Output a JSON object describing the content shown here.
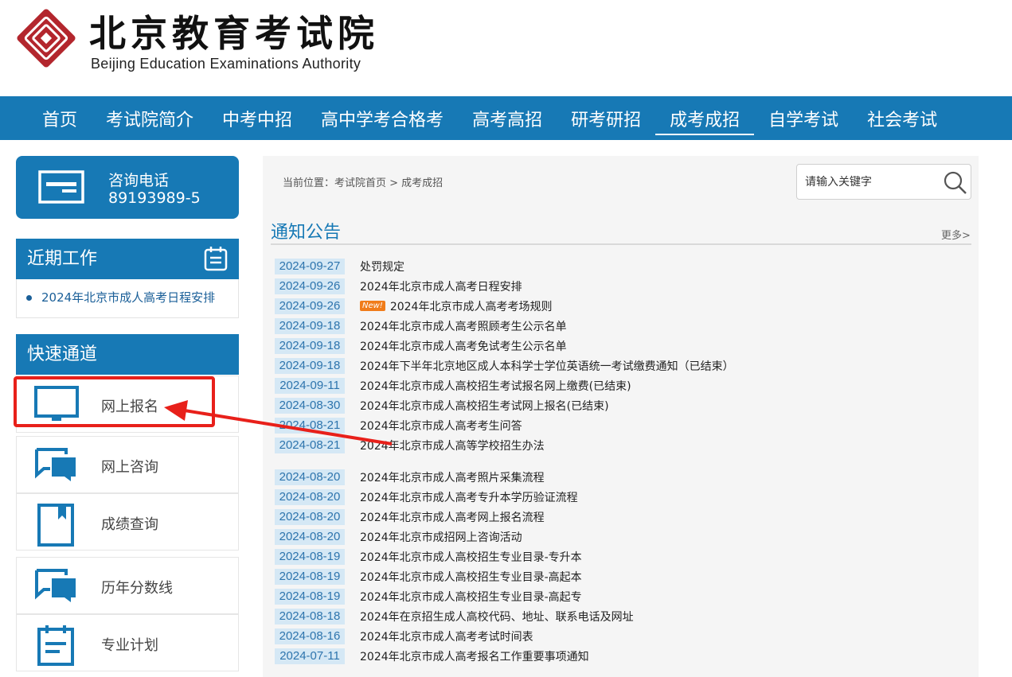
{
  "header": {
    "logo_cn": "北京教育考试院",
    "logo_en": "Beijing Education Examinations Authority"
  },
  "nav": {
    "items": [
      "首页",
      "考试院简介",
      "中考中招",
      "高中学考合格考",
      "高考高招",
      "研考研招",
      "成考成招",
      "自学考试",
      "社会考试"
    ],
    "active": "成考成招"
  },
  "hotline": {
    "label": "咨询电话",
    "number": "89193989-5"
  },
  "recent": {
    "title": "近期工作",
    "item": "2024年北京市成人高考日程安排"
  },
  "quick": {
    "title": "快速通道",
    "items": [
      "网上报名",
      "网上咨询",
      "成绩查询",
      "历年分数线",
      "专业计划"
    ]
  },
  "breadcrumb": "当前位置：考试院首页 > 成考成招",
  "search": {
    "placeholder": "请输入关键字"
  },
  "notice": {
    "title": "通知公告",
    "more": "更多>"
  },
  "news": [
    {
      "date": "2024-09-27",
      "title": "处罚规定"
    },
    {
      "date": "2024-09-26",
      "title": "2024年北京市成人高考日程安排"
    },
    {
      "date": "2024-09-26",
      "title": "2024年北京市成人高考考场规则",
      "badge": "New!"
    },
    {
      "date": "2024-09-18",
      "title": "2024年北京市成人高考照顾考生公示名单"
    },
    {
      "date": "2024-09-18",
      "title": "2024年北京市成人高考免试考生公示名单"
    },
    {
      "date": "2024-09-18",
      "title": "2024年下半年北京地区成人本科学士学位英语统一考试缴费通知（已结束）"
    },
    {
      "date": "2024-09-11",
      "title": "2024年北京市成人高校招生考试报名网上缴费(已结束)"
    },
    {
      "date": "2024-08-30",
      "title": "2024年北京市成人高校招生考试网上报名(已结束)"
    },
    {
      "date": "2024-08-21",
      "title": "2024年北京市成人高考考生问答"
    },
    {
      "date": "2024-08-21",
      "title": "2024年北京市成人高等学校招生办法"
    },
    {
      "date": "2024-08-20",
      "title": "2024年北京市成人高考照片采集流程"
    },
    {
      "date": "2024-08-20",
      "title": "2024年北京市成人高考专升本学历验证流程"
    },
    {
      "date": "2024-08-20",
      "title": "2024年北京市成人高考网上报名流程"
    },
    {
      "date": "2024-08-20",
      "title": "2024年北京市成招网上咨询活动"
    },
    {
      "date": "2024-08-19",
      "title": "2024年北京市成人高校招生专业目录-专升本"
    },
    {
      "date": "2024-08-19",
      "title": "2024年北京市成人高校招生专业目录-高起本"
    },
    {
      "date": "2024-08-19",
      "title": "2024年北京市成人高校招生专业目录-高起专"
    },
    {
      "date": "2024-08-18",
      "title": "2024年在京招生成人高校代码、地址、联系电话及网址"
    },
    {
      "date": "2024-08-16",
      "title": "2024年北京市成人高考考试时间表"
    },
    {
      "date": "2024-07-11",
      "title": "2024年北京市成人高考报名工作重要事项通知"
    }
  ],
  "colors": {
    "brand_blue": "#1779b5",
    "date_bg": "#d5e8f5",
    "annotation_red": "#e8201a",
    "new_badge": "#f07c1a"
  }
}
